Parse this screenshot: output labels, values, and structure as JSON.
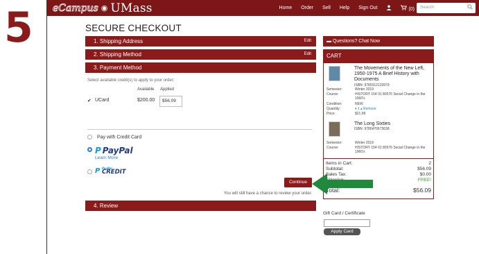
{
  "step_number": "5",
  "brand": {
    "name_left": "eCampus",
    "separator": "◉",
    "name_right": "UMass"
  },
  "nav": {
    "items": [
      "Home",
      "Order",
      "Sell",
      "Help",
      "Sign Out"
    ],
    "cart_label": "(0)",
    "search_placeholder": "Search"
  },
  "page_title": "SECURE CHECKOUT",
  "steps": {
    "shipping_address": {
      "label": "1. Shipping Address",
      "edit": "Edit"
    },
    "shipping_method": {
      "label": "2. Shipping Method",
      "edit": "Edit"
    },
    "payment_method": {
      "label": "3. Payment Method"
    },
    "review": {
      "label": "4. Review"
    }
  },
  "credits": {
    "intro": "Select available credit(s) to apply to your order:",
    "col_available": "Available",
    "col_applied": "Applied",
    "rows": [
      {
        "checked": true,
        "name": "UCard",
        "available": "$200.00",
        "applied": "$56.09"
      }
    ]
  },
  "payment_options": {
    "credit_card": "Pay with Credit Card",
    "paypal": "PayPal",
    "learn_more": "Learn More",
    "paypal_credit_small": "PayPal",
    "paypal_credit_big": "CREDIT"
  },
  "continue_label": "Continue",
  "review_note": "You will still have a chance to review your order.",
  "sidebar": {
    "questions": "Questions? Chat Now",
    "cart_title": "CART",
    "books": [
      {
        "title": "The Movements of the New Left, 1950-1975 A Brief History with Documents",
        "isbn": "ISBN: 9780312133979",
        "semester_label": "Semester:",
        "semester": "Winter 2019",
        "course_label": "Course:",
        "course": "HISTORY 154 01 80576 Social Change in the 1960's",
        "condition_label": "Condition:",
        "condition": "NEW",
        "quantity_label": "Quantity:",
        "quantity": "▾ 1 ▴ Remove",
        "price_label": "Price:",
        "price": "$21.99"
      },
      {
        "title": "The Long Sixties",
        "isbn": "ISBN: 9780470673638",
        "semester_label": "Semester:",
        "semester": "Winter 2019",
        "course_label": "Course:",
        "course": "HISTORY 154 01 80576 Social Change in the 1960's"
      }
    ],
    "summary": {
      "items_label": "Items in Cart:",
      "items": "2",
      "subtotal_label": "Subtotal:",
      "subtotal": "$56.09",
      "tax_label": "Sales Tax:",
      "tax": "$0.00",
      "shipping_label": "Shipping:",
      "shipping": "FREE!",
      "total_label": "Total:",
      "total": "$56.09"
    },
    "gift_card_label": "Gift Card / Certificate",
    "apply_card": "Apply Card"
  },
  "colors": {
    "brand": "#8b1a1a",
    "annotation_arrow": "#1f8a3c",
    "link": "#2a7fd4"
  }
}
